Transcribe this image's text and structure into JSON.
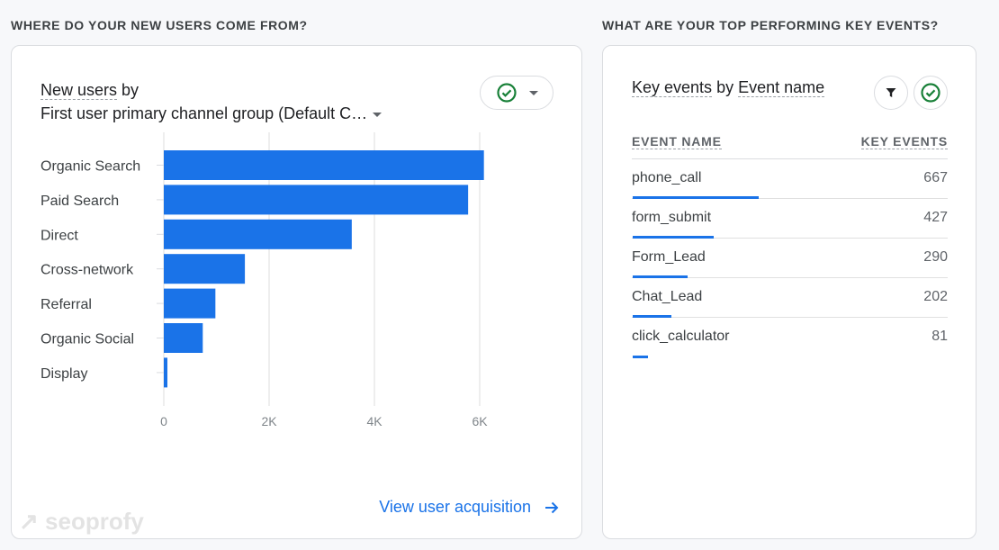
{
  "left_section": {
    "heading": "WHERE DO YOUR NEW USERS COME FROM?",
    "card": {
      "title_metric": "New users",
      "title_by": " by",
      "dimension_selector": "First user primary channel group (Default C…",
      "compare_status_icon": "check-circle-icon",
      "link_label": "View user acquisition",
      "link_icon": "arrow-right-icon"
    }
  },
  "right_section": {
    "heading": "WHAT ARE YOUR TOP PERFORMING KEY EVENTS?",
    "card": {
      "title_metric": "Key events",
      "title_by": " by ",
      "title_dimension": "Event name",
      "filter_icon": "filter-icon",
      "status_icon": "check-circle-icon",
      "columns": [
        "EVENT NAME",
        "KEY EVENTS"
      ],
      "rows": [
        {
          "name": "phone_call",
          "value": "667",
          "share": 667
        },
        {
          "name": "form_submit",
          "value": "427",
          "share": 427
        },
        {
          "name": "Form_Lead",
          "value": "290",
          "share": 290
        },
        {
          "name": "Chat_Lead",
          "value": "202",
          "share": 202
        },
        {
          "name": "click_calculator",
          "value": "81",
          "share": 81
        }
      ],
      "bar_max": 1667
    }
  },
  "watermark": "seoprofy",
  "colors": {
    "accent": "#1a73e8",
    "check": "#188038"
  },
  "chart_data": {
    "type": "bar",
    "orientation": "horizontal",
    "title": "New users by First user primary channel group (Default Channel Group)",
    "categories": [
      "Organic Search",
      "Paid Search",
      "Direct",
      "Cross-network",
      "Referral",
      "Organic Social",
      "Display"
    ],
    "values": [
      6080,
      5780,
      3570,
      1540,
      980,
      740,
      60
    ],
    "xlabel": "",
    "ylabel": "",
    "xlim": [
      0,
      6000
    ],
    "xticks": [
      0,
      2000,
      4000,
      6000
    ],
    "xtick_labels": [
      "0",
      "2K",
      "4K",
      "6K"
    ],
    "grid": true,
    "legend": "none"
  }
}
